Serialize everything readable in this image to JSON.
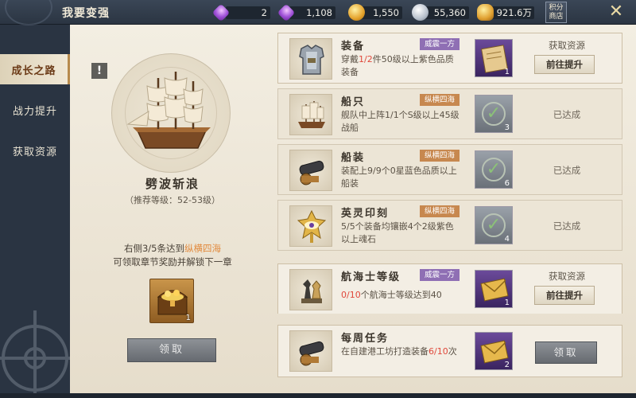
{
  "header": {
    "title": "我要变强",
    "currencies": [
      {
        "name": "diamond",
        "icon": "purple-diamond-icon",
        "value": "2"
      },
      {
        "name": "bound-diamond",
        "icon": "purple-gem-icon",
        "value": "1,108"
      },
      {
        "name": "gold-coin",
        "icon": "gold-coin-icon",
        "value": "1,550"
      },
      {
        "name": "silver-coin",
        "icon": "silver-coin-icon",
        "value": "55,360"
      },
      {
        "name": "gold-ingot",
        "icon": "gold-ingot-icon",
        "value": "921.6万"
      }
    ],
    "points_shop_label": "积分商店",
    "close_icon": "close-x-icon"
  },
  "sidebar": {
    "tabs": [
      {
        "label": "成长之路",
        "active": true
      },
      {
        "label": "战力提升",
        "active": false
      },
      {
        "label": "获取资源",
        "active": false
      }
    ]
  },
  "chapter": {
    "info_badge": "!",
    "name": "劈波斩浪",
    "recommend": "（推荐等级：52-53级）",
    "reward_desc_prefix": "右侧",
    "reward_progress": "3/5",
    "reward_desc_mid": "条达到",
    "reward_tier": "纵横四海",
    "reward_desc_line2": "可领取章节奖励并解锁下一章",
    "chest_count": "1",
    "claim_label": "领取"
  },
  "tasks": [
    {
      "name": "装备",
      "tag": "威震一方",
      "tag_color": "#8f6fb4",
      "desc_pre": "穿戴",
      "desc_hl": "1/2",
      "desc_post": "件50级以上紫色品质装备",
      "reward_count": "1",
      "status": "pending",
      "get_res_label": "获取资源",
      "goto_label": "前往提升"
    },
    {
      "name": "船只",
      "tag": "纵横四海",
      "tag_color": "#c7884f",
      "desc_pre": "",
      "desc_hl": "",
      "desc_post": "舰队中上阵1/1个S级以上45级战船",
      "reward_count": "3",
      "status": "done",
      "status_label": "已达成"
    },
    {
      "name": "船装",
      "tag": "纵横四海",
      "tag_color": "#c7884f",
      "desc_pre": "",
      "desc_hl": "",
      "desc_post": "装配上9/9个0星蓝色品质以上船装",
      "reward_count": "6",
      "status": "done",
      "status_label": "已达成"
    },
    {
      "name": "英灵印刻",
      "tag": "纵横四海",
      "tag_color": "#c7884f",
      "desc_pre": "",
      "desc_hl": "",
      "desc_post": "5/5个装备均镶嵌4个2级紫色以上魂石",
      "reward_count": "4",
      "status": "done",
      "status_label": "已达成"
    },
    {
      "name": "航海士等级",
      "tag": "威震一方",
      "tag_color": "#8f6fb4",
      "desc_pre": "",
      "desc_hl": "0/10",
      "desc_post": "个航海士等级达到40",
      "reward_count": "1",
      "status": "pending",
      "get_res_label": "获取资源",
      "goto_label": "前往提升"
    }
  ],
  "weekly": {
    "name": "每周任务",
    "desc_pre": "在自建港工坊打造装备",
    "desc_hl": "6/10",
    "desc_post": "次",
    "reward_count": "2",
    "claim_label": "领取"
  }
}
